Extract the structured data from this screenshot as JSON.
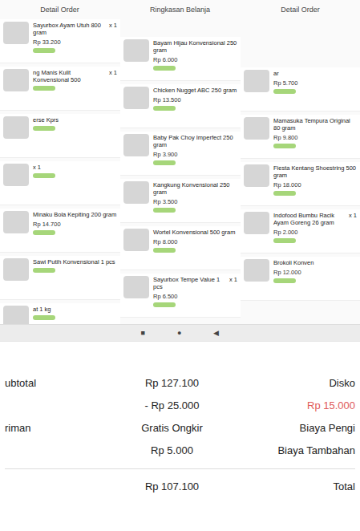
{
  "headers": [
    "Detail Order",
    "Ringkasan Belanja",
    "Detail Order"
  ],
  "columns": [
    {
      "items": [
        {
          "name": "Sayurbox Ayam Utuh 800 gram",
          "price": "Rp 33.200",
          "qty": "x 1"
        },
        {
          "name": "ng Manis Kulit Konvensional 500",
          "qty": "x 1"
        },
        {
          "name": "erse Kprs"
        },
        {
          "qty": "x 1"
        },
        {
          "name": "Minaku Bola Kepiting 200 gram",
          "price": "Rp 14.700"
        },
        {
          "name": "Sawi Putih Konvensional 1 pcs"
        },
        {
          "name": "at 1 kg"
        }
      ]
    },
    {
      "items": [
        {
          "name": "Bayam Hijau Konvensional 250 gram",
          "price": "Rp 6.000"
        },
        {
          "name": "Chicken Nugget ABC 250 gram",
          "price": "Rp 13.500"
        },
        {
          "name": "Baby Pak Choy Imperfect 250 gram",
          "price": "Rp 3.900"
        },
        {
          "name": "Kangkung Konvensional 250 gram",
          "price": "Rp 3.500"
        },
        {
          "name": "Wortel Konvensional 500 gram",
          "price": "Rp 8.000"
        },
        {
          "name": "Sayurbox Tempe Value 1 pcs",
          "price": "Rp 6.500",
          "qty": "x 1"
        }
      ]
    },
    {
      "items": [
        {
          "name": "ar",
          "price": "Rp 5.700"
        },
        {
          "name": "Mamasuka Tempura Original 80 gram",
          "price": "Rp 9.800"
        },
        {
          "name": "Fiesta Kentang Shoestring 500 gram",
          "price": "Rp 18.000"
        },
        {
          "name": "Indofood Bumbu Racik Ayam Goreng 26 gram",
          "price": "Rp 2.000",
          "qty": "x 1"
        },
        {
          "name": "Brokoli Konven",
          "price": "Rp 12.000"
        }
      ]
    }
  ],
  "nav": [
    "■",
    "●",
    "◀"
  ],
  "summary": {
    "rows": [
      {
        "cells": [
          {
            "text": "ubtotal",
            "color": "#222222"
          },
          {
            "text": "Rp 127.100",
            "color": "#222222"
          },
          {
            "text": "Disko",
            "color": "#222222"
          }
        ]
      },
      {
        "cells": [
          {
            "text": "",
            "color": "#222222"
          },
          {
            "text": "- Rp 25.000",
            "color": "#222222"
          },
          {
            "text": "Rp 15.000",
            "color": "#e05a5a"
          }
        ]
      },
      {
        "cells": [
          {
            "text": "riman",
            "color": "#222222"
          },
          {
            "text": "Gratis Ongkir",
            "color": "#222222"
          },
          {
            "text": "Biaya Pengi",
            "color": "#222222"
          }
        ]
      },
      {
        "cells": [
          {
            "text": "",
            "color": "#222222"
          },
          {
            "text": "Rp 5.000",
            "color": "#222222"
          },
          {
            "text": "Biaya Tambahan",
            "color": "#222222"
          }
        ]
      },
      {
        "cells": [
          {
            "text": "",
            "color": "#222222"
          },
          {
            "text": "Rp 107.100",
            "color": "#222222"
          },
          {
            "text": "Total",
            "color": "#222222"
          }
        ]
      }
    ]
  }
}
